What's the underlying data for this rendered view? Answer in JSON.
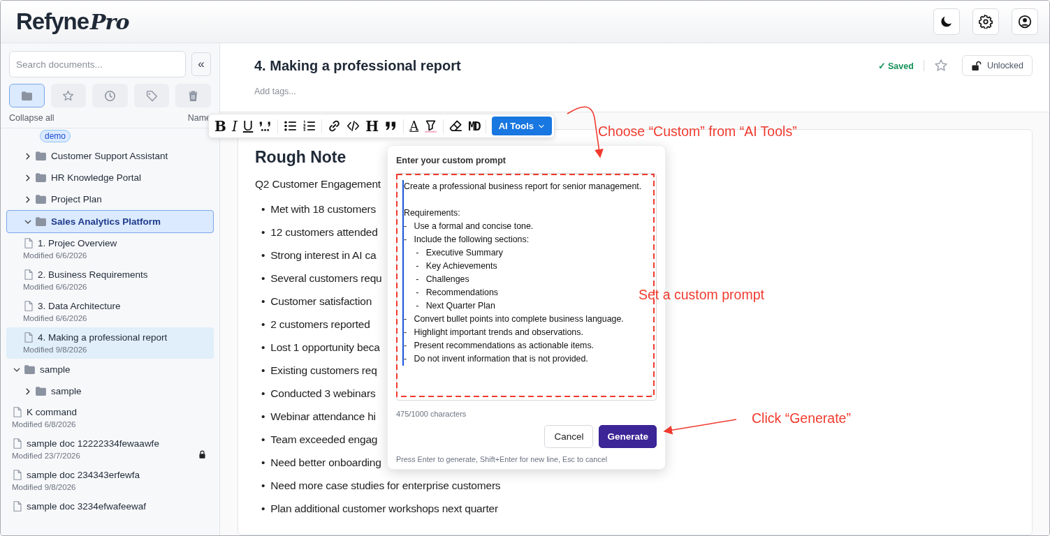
{
  "header": {
    "logo": {
      "text": "Refyne",
      "accent": "Pro"
    }
  },
  "sidebar": {
    "search": {
      "placeholder": "Search documents..."
    },
    "collapse_button": "«",
    "filter_tabs": [
      {
        "selected": true
      },
      {
        "selected": false
      },
      {
        "selected": false
      },
      {
        "selected": false
      },
      {
        "selected": false
      }
    ],
    "collapse_all": "Collapse all",
    "sort": "Name",
    "tree": [
      {
        "kind": "folder_tail",
        "tags": [
          "demo"
        ],
        "children": [
          {
            "kind": "folder",
            "name": "Customer Support Assistant",
            "expanded": false,
            "selected": false
          },
          {
            "kind": "folder",
            "name": "HR Knowledge Portal",
            "expanded": false,
            "selected": false
          },
          {
            "kind": "folder",
            "name": "Project Plan",
            "expanded": false,
            "selected": false
          },
          {
            "kind": "folder",
            "name": "Sales Analytics Platform",
            "expanded": true,
            "selected": true,
            "children": [
              {
                "kind": "doc",
                "name": "1. Projec Overview",
                "modified": "Modified 6/6/2026",
                "selected": false,
                "locked": false
              },
              {
                "kind": "doc",
                "name": "2. Business Requirements",
                "modified": "Modified 6/6/2026",
                "selected": false,
                "locked": false
              },
              {
                "kind": "doc",
                "name": "3. Data Architecture",
                "modified": "Modified 6/6/2026",
                "selected": false,
                "locked": false
              },
              {
                "kind": "doc",
                "name": "4. Making a professional report",
                "modified": "Modified 9/8/2026",
                "selected": true,
                "locked": false
              }
            ]
          }
        ]
      },
      {
        "kind": "folder",
        "name": "sample",
        "expanded": true,
        "selected": false,
        "children": [
          {
            "kind": "folder",
            "name": "sample",
            "expanded": false,
            "selected": false
          },
          {
            "kind": "doc",
            "name": "K command",
            "modified": "Modified 6/8/2026",
            "selected": false,
            "locked": false
          },
          {
            "kind": "doc",
            "name": "sample doc 12222334fewaawfe",
            "modified": "Modified 23/7/2026",
            "selected": false,
            "locked": true
          },
          {
            "kind": "doc",
            "name": "sample doc 234343erfewfa",
            "modified": "Modified 9/8/2026",
            "selected": false,
            "locked": false
          },
          {
            "kind": "doc",
            "name": "sample doc 3234efwafeewaf",
            "selected": false,
            "locked": false
          }
        ]
      }
    ]
  },
  "document": {
    "title": "4. Making a professional report",
    "tags_placeholder": "Add tags...",
    "status": "✓ Saved",
    "starred": false,
    "lock_button": {
      "label": "Unlocked",
      "locked": false
    }
  },
  "toolbar": {
    "glyphs": [
      "B",
      "I",
      "U",
      "H",
      "A",
      "MD"
    ],
    "ai_button": "AI Tools"
  },
  "content": {
    "heading": "Rough Note",
    "intro": "Q2 Customer Engagement",
    "bullet_marker": "•",
    "bullets": [
      "Met with 18 customers",
      "12 customers attended",
      "Strong interest in AI ca",
      "Several customers requ",
      "Customer satisfaction",
      "2 customers reported",
      "Lost 1 opportunity beca",
      "Existing customers req",
      "Conducted 3 webinars",
      "Webinar attendance hi",
      "Team exceeded engag",
      "Need better onboarding",
      "Need more case studies for enterprise customers",
      "Plan additional customer workshops next quarter"
    ]
  },
  "prompt_dialog": {
    "title": "Enter your custom prompt",
    "value": "Create a professional business report for senior management.\n\nRequirements:\n-   Use a formal and concise tone.\n-   Include the following sections:\n     -   Executive Summary\n     -   Key Achievements\n     -   Challenges\n     -   Recommendations\n     -   Next Quarter Plan\n-   Convert bullet points into complete business language.\n-   Highlight important trends and observations.\n-   Present recommendations as actionable items.\n-   Do not invent information that is not provided.",
    "counter": "475/1000 characters",
    "buttons": [
      {
        "label": "Cancel",
        "kind": "secondary"
      },
      {
        "label": "Generate",
        "kind": "primary"
      }
    ],
    "hint": "Press Enter to generate, Shift+Enter for new line, Esc to cancel"
  },
  "annotations": [
    {
      "text": "Choose “Custom” from “AI Tools”"
    },
    {
      "text": "Set a custom prompt"
    },
    {
      "text": "Click “Generate”"
    }
  ]
}
